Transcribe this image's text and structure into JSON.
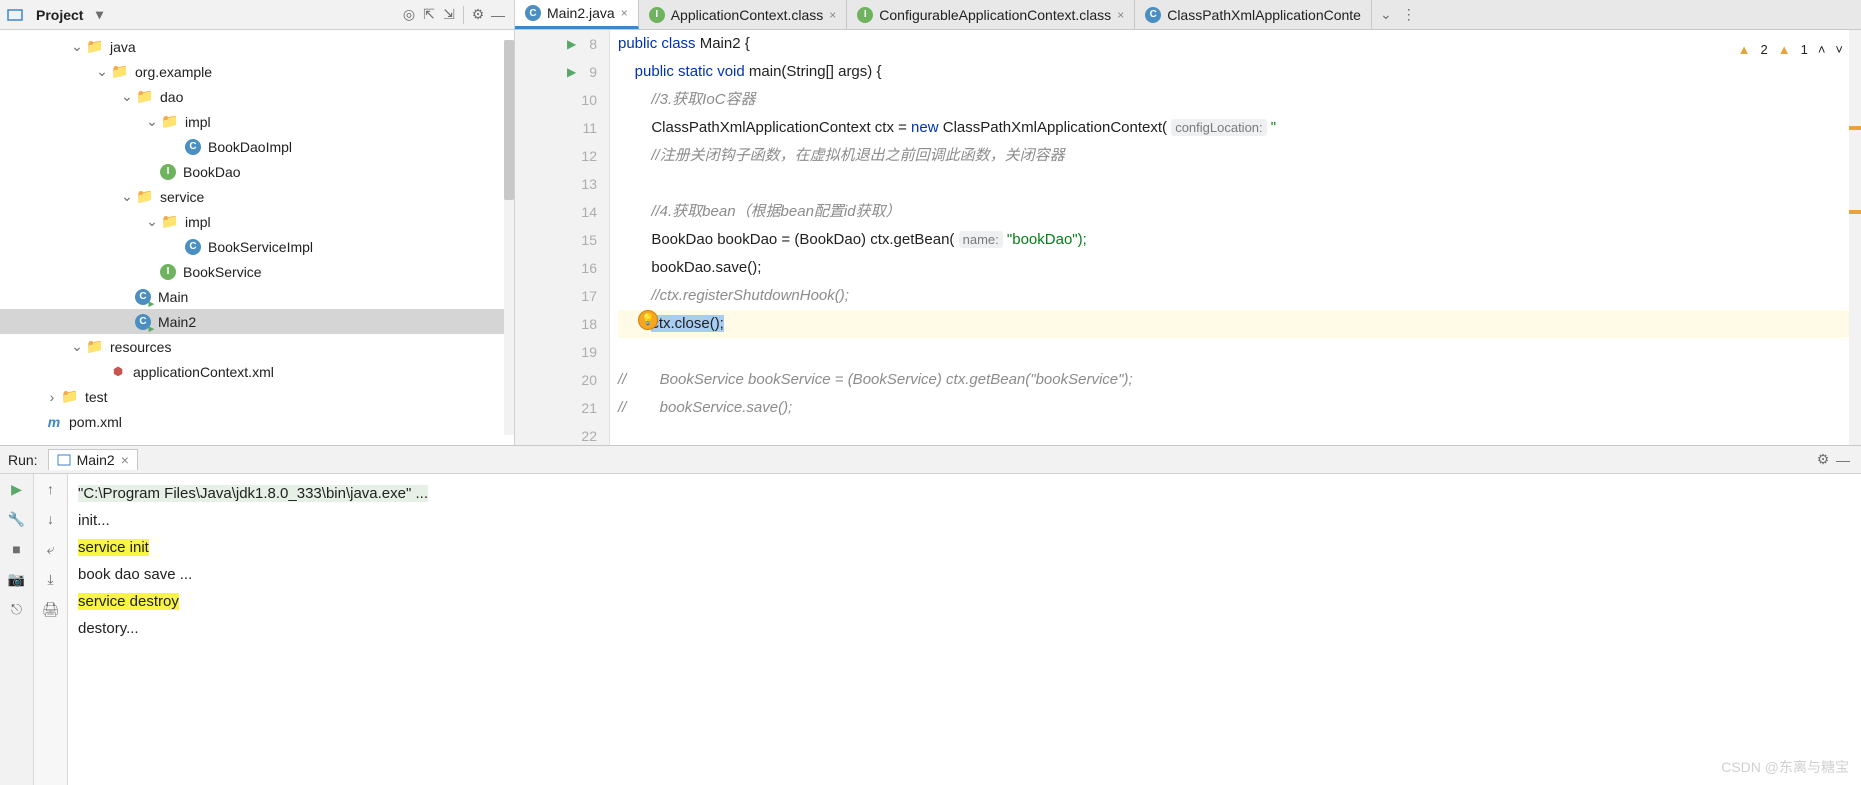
{
  "project": {
    "title": "Project",
    "tree": {
      "java": "java",
      "pkg": "org.example",
      "dao": "dao",
      "dao_impl": "impl",
      "BookDaoImpl": "BookDaoImpl",
      "BookDao": "BookDao",
      "service": "service",
      "service_impl": "impl",
      "BookServiceImpl": "BookServiceImpl",
      "BookService": "BookService",
      "Main": "Main",
      "Main2": "Main2",
      "resources": "resources",
      "appctx": "applicationContext.xml",
      "test": "test",
      "pom": "pom.xml"
    }
  },
  "tabs": [
    {
      "label": "Main2.java",
      "iconClass": "ci-c"
    },
    {
      "label": "ApplicationContext.class",
      "iconClass": "ci-i"
    },
    {
      "label": "ConfigurableApplicationContext.class",
      "iconClass": "ci-i"
    },
    {
      "label": "ClassPathXmlApplicationConte",
      "iconClass": "ci-c"
    }
  ],
  "status": {
    "warn1": "2",
    "warn2": "1"
  },
  "code": {
    "l8": "public class Main2 {",
    "l9": "    public static void main(String[] args) {",
    "l10": "        //3.获取IoC容器",
    "l11a": "        ClassPathXmlApplicationContext ctx = ",
    "l11b": "new",
    "l11c": " ClassPathXmlApplicationContext( ",
    "l11hint": "configLocation:",
    "l11d": " \"",
    "l12": "        //注册关闭钩子函数，在虚拟机退出之前回调此函数，关闭容器",
    "l13": "",
    "l14": "        //4.获取bean（根据bean配置id获取）",
    "l15a": "        BookDao bookDao = (BookDao) ctx.getBean( ",
    "l15hint": "name:",
    "l15b": " \"bookDao\");",
    "l16": "        bookDao.save();",
    "l17": "        //ctx.registerShutdownHook();",
    "l18": "        ctx.close();",
    "l19": "",
    "l20": "//        BookService bookService = (BookService) ctx.getBean(\"bookService\");",
    "l21": "//        bookService.save();",
    "l22": ""
  },
  "run": {
    "label": "Run:",
    "config": "Main2",
    "cmd": "\"C:\\Program Files\\Java\\jdk1.8.0_333\\bin\\java.exe\" ...",
    "l1": "init...",
    "l2": "service init",
    "l3": "book dao save ...",
    "l4": "service destroy",
    "l5": "destory..."
  },
  "watermark": "CSDN @东离与糖宝"
}
